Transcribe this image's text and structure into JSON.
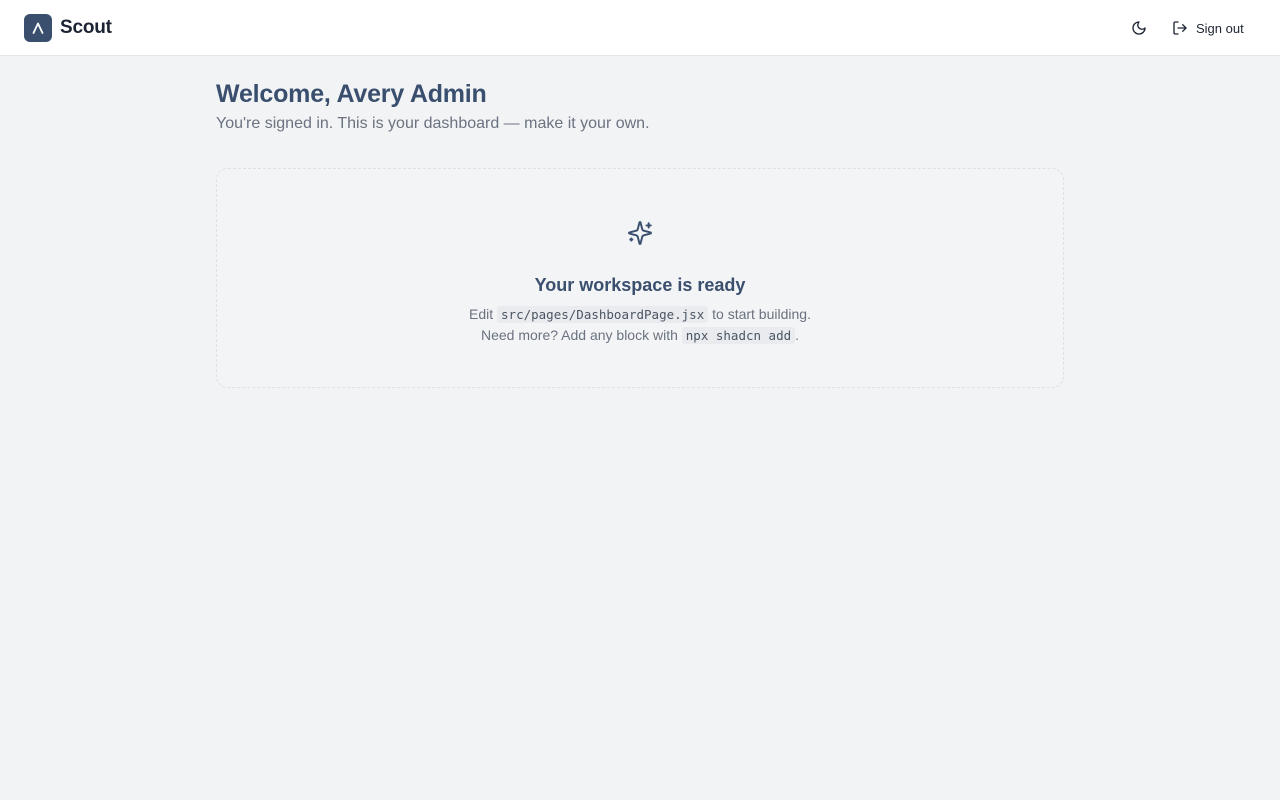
{
  "app": {
    "name": "Scout",
    "logo_icon": "chevron-up-icon",
    "colors": {
      "brand": "#3a4f6e",
      "background": "#f2f3f5"
    }
  },
  "header": {
    "theme_toggle_icon": "moon-icon",
    "signout_icon": "log-out-icon",
    "signout_label": "Sign out"
  },
  "welcome": {
    "title": "Welcome, Avery Admin",
    "subtitle": "You're signed in. This is your dashboard — make it your own."
  },
  "panel": {
    "icon": "sparkles-icon",
    "title": "Your workspace is ready",
    "line1_prefix": "Edit",
    "line1_code": "src/pages/DashboardPage.jsx",
    "line1_suffix": "to start building.",
    "line2_prefix": "Need more? Add any block with",
    "line2_code": "npx shadcn add",
    "line2_suffix": "."
  }
}
